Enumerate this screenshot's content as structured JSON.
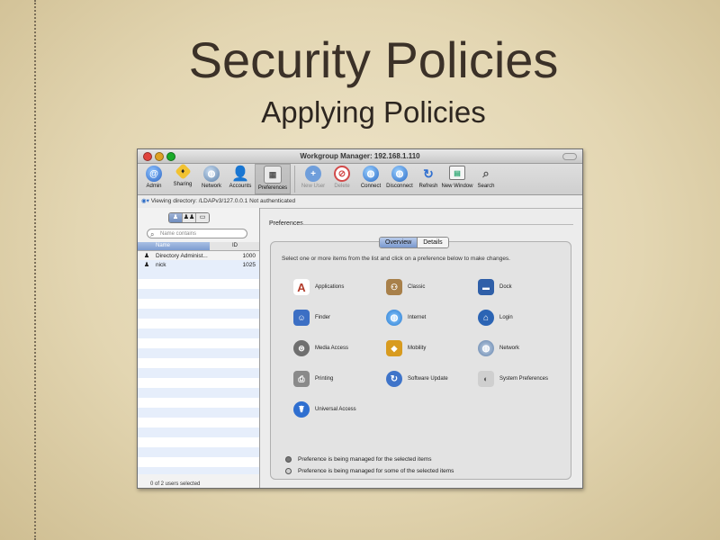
{
  "slide": {
    "title": "Security Policies",
    "subtitle": "Applying Policies"
  },
  "window": {
    "title": "Workgroup Manager: 192.168.1.110"
  },
  "toolbar": {
    "items": [
      {
        "label": "Admin",
        "icon": "globe-admin-icon"
      },
      {
        "label": "Sharing",
        "icon": "sharing-sign-icon"
      },
      {
        "label": "Network",
        "icon": "network-globe-icon"
      },
      {
        "label": "Accounts",
        "icon": "accounts-person-icon"
      },
      {
        "label": "Preferences",
        "icon": "preferences-panel-icon"
      },
      {
        "label": "New User",
        "icon": "plus-icon"
      },
      {
        "label": "Delete",
        "icon": "delete-icon"
      },
      {
        "label": "Connect",
        "icon": "connect-globe-icon"
      },
      {
        "label": "Disconnect",
        "icon": "disconnect-globe-icon"
      },
      {
        "label": "Refresh",
        "icon": "refresh-icon"
      },
      {
        "label": "New Window",
        "icon": "new-window-icon"
      },
      {
        "label": "Search",
        "icon": "search-icon"
      }
    ]
  },
  "directory": {
    "text": "Viewing directory: /LDAPv3/127.0.0.1   Not authenticated"
  },
  "sidebar": {
    "filter_placeholder": "Name contains",
    "columns": {
      "name": "Name",
      "id": "ID"
    },
    "users": [
      {
        "name": "Directory Administ...",
        "id": "1000"
      },
      {
        "name": "nick",
        "id": "1025"
      }
    ],
    "status": "0 of 2 users selected"
  },
  "preferences": {
    "label": "Preferences",
    "tabs": [
      {
        "label": "Overview",
        "active": true
      },
      {
        "label": "Details",
        "active": false
      }
    ],
    "instruction": "Select one or more items from the list and click on a preference below to make changes.",
    "items": [
      {
        "label": "Applications",
        "icon": "applications-icon",
        "color": "#b23b2a"
      },
      {
        "label": "Classic",
        "icon": "classic-icon",
        "color": "#a8804a"
      },
      {
        "label": "Dock",
        "icon": "dock-icon",
        "color": "#2f5fa8"
      },
      {
        "label": "Finder",
        "icon": "finder-icon",
        "color": "#3c6fc4"
      },
      {
        "label": "Internet",
        "icon": "internet-icon",
        "color": "#2a7bd0"
      },
      {
        "label": "Login",
        "icon": "login-icon",
        "color": "#2b64b4"
      },
      {
        "label": "Media Access",
        "icon": "media-access-icon",
        "color": "#6f6f6f"
      },
      {
        "label": "Mobility",
        "icon": "mobility-icon",
        "color": "#d89b1f"
      },
      {
        "label": "Network",
        "icon": "network-icon",
        "color": "#5f7fa8"
      },
      {
        "label": "Printing",
        "icon": "printing-icon",
        "color": "#8a8a8a"
      },
      {
        "label": "Software Update",
        "icon": "software-update-icon",
        "color": "#3f74c9"
      },
      {
        "label": "System Preferences",
        "icon": "system-preferences-icon",
        "color": "#9a9a9a"
      },
      {
        "label": "Universal Access",
        "icon": "universal-access-icon",
        "color": "#2f6fd0"
      }
    ],
    "legend": [
      "Preference is being managed for the selected items",
      "Preference is being managed for some of the selected items"
    ]
  }
}
